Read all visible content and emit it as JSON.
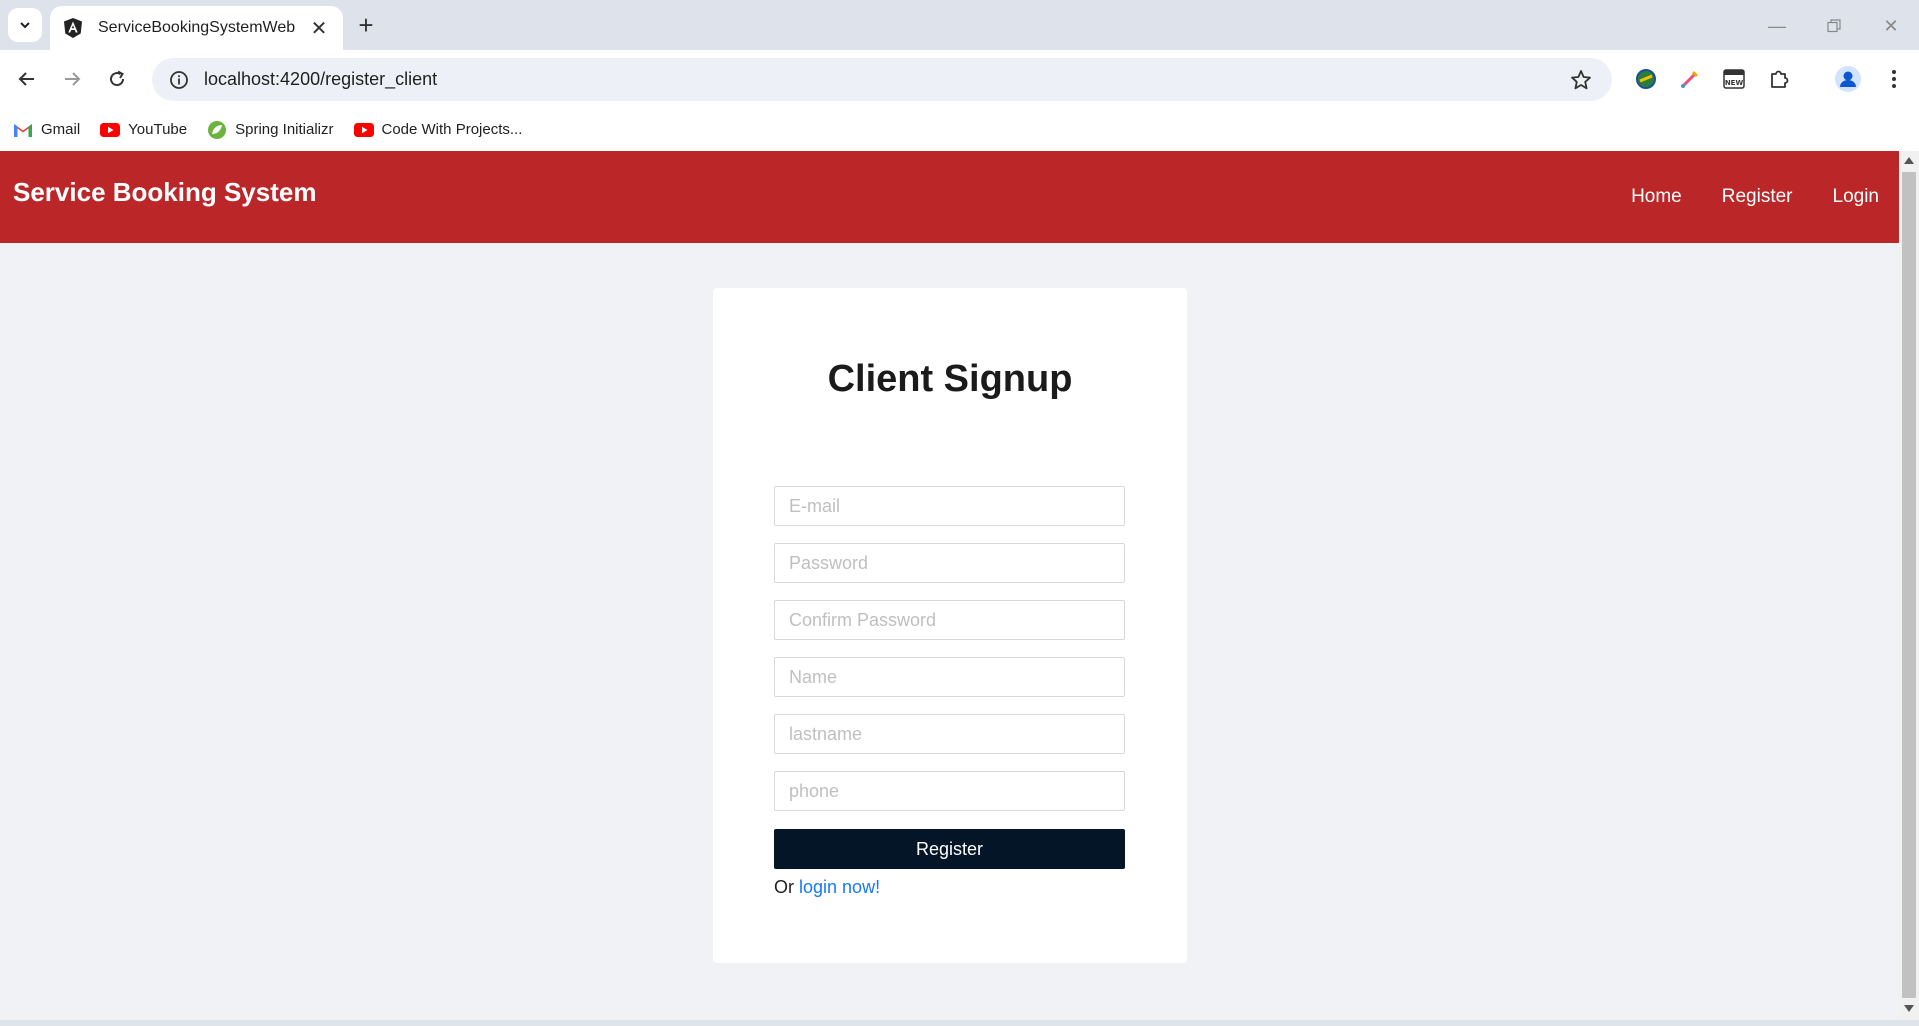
{
  "browser": {
    "tab_title": "ServiceBookingSystemWeb",
    "url": "localhost:4200/register_client",
    "bookmarks": [
      {
        "label": "Gmail",
        "icon": "gmail-icon"
      },
      {
        "label": "YouTube",
        "icon": "youtube-icon"
      },
      {
        "label": "Spring Initializr",
        "icon": "spring-icon"
      },
      {
        "label": "Code With Projects...",
        "icon": "youtube-icon"
      }
    ]
  },
  "navbar": {
    "brand": "Service Booking System",
    "links": [
      "Home",
      "Register",
      "Login"
    ]
  },
  "form": {
    "title": "Client Signup",
    "email_placeholder": "E-mail",
    "password_placeholder": "Password",
    "confirm_placeholder": "Confirm Password",
    "name_placeholder": "Name",
    "lastname_placeholder": "lastname",
    "phone_placeholder": "phone",
    "submit_label": "Register",
    "login_prefix": "Or",
    "login_link": "login now!"
  },
  "colors": {
    "navbar": "#bb2628",
    "button": "#051528",
    "link": "#1677ff"
  }
}
